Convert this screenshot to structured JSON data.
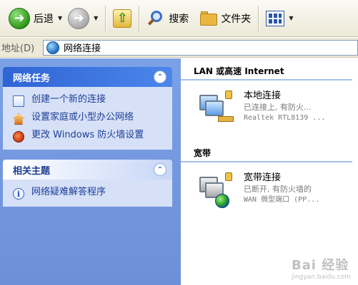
{
  "toolbar": {
    "back_label": "后退",
    "search_label": "搜索",
    "folders_label": "文件夹"
  },
  "address": {
    "label": "地址(D)",
    "value": "网络连接"
  },
  "left_pane": {
    "network_tasks": {
      "title": "网络任务",
      "items": [
        {
          "label": "创建一个新的连接",
          "icon": "new-connection-icon"
        },
        {
          "label": "设置家庭或小型办公网络",
          "icon": "home-network-icon"
        },
        {
          "label": "更改 Windows 防火墙设置",
          "icon": "firewall-icon"
        }
      ]
    },
    "related_topics": {
      "title": "相关主题",
      "items": [
        {
          "label": "网络疑难解答程序",
          "icon": "info-icon"
        }
      ]
    }
  },
  "right_pane": {
    "lan_group": {
      "title": "LAN 或高速 Internet",
      "connection": {
        "name": "本地连接",
        "status": "已连接上, 有防火...",
        "device": "Realtek RTL8139 ..."
      }
    },
    "broadband_group": {
      "title": "宽带",
      "connection": {
        "name": "宽带连接",
        "status": "已断开, 有防火墙的",
        "device": "WAN 微型端口 (PP..."
      }
    }
  },
  "watermark": {
    "text": "Bai 经验",
    "sub": "jingyan.baidu.com"
  },
  "colors": {
    "left_pane_bg": "#7aa1e6",
    "panel_header": "#2f64d5",
    "link_text": "#1d3f97"
  }
}
